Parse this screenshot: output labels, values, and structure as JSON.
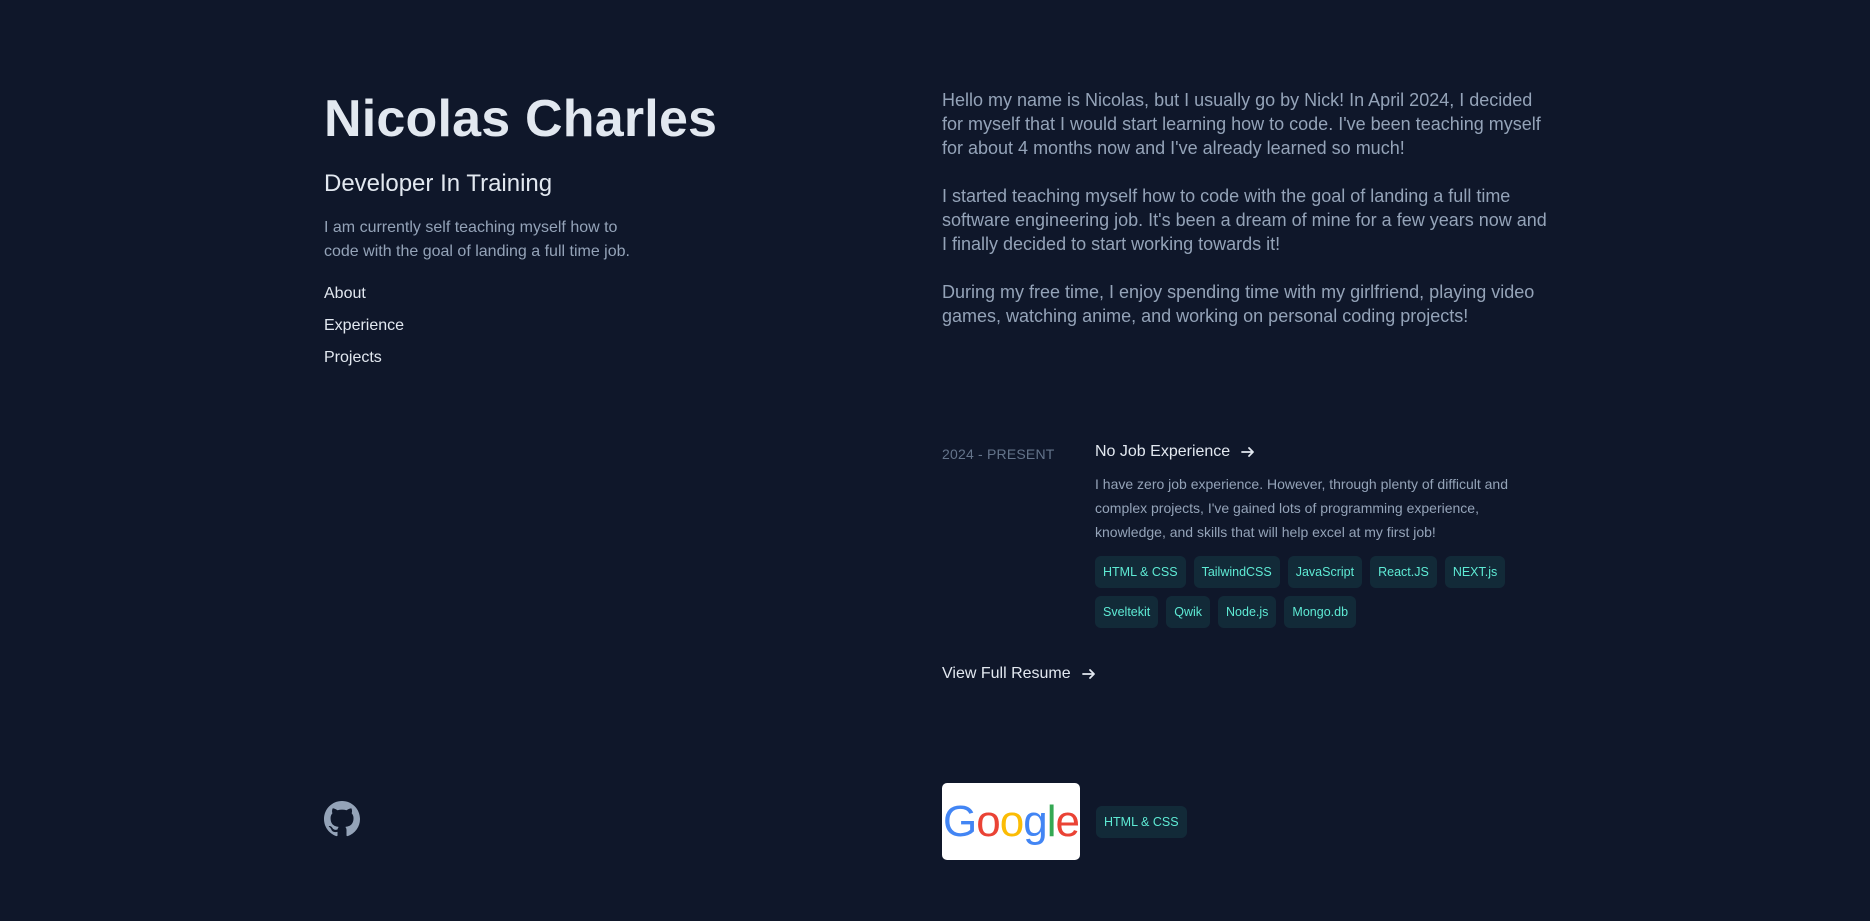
{
  "header": {
    "name": "Nicolas Charles",
    "role": "Developer In Training",
    "tagline": "I am currently self teaching myself how to code with the goal of landing a full time job."
  },
  "nav": {
    "about": "About",
    "experience": "Experience",
    "projects": "Projects"
  },
  "social": {
    "github_icon": "github-icon"
  },
  "about": {
    "p1": "Hello my name is Nicolas, but I usually go by Nick! In April 2024, I decided for myself that I would start learning how to code. I've been teaching myself for about 4 months now and I've already learned so much!",
    "p2": "I started teaching myself how to code with the goal of landing a full time software engineering job. It's been a dream of mine for a few years now and I finally decided to start working towards it!",
    "p3": "During my free time, I enjoy spending time with my girlfriend, playing video games, watching anime, and working on personal coding projects!"
  },
  "experience": {
    "date": "2024 - PRESENT",
    "title": "No Job Experience",
    "description": "I have zero job experience. However, through plenty of difficult and complex projects, I've gained lots of programming experience, knowledge, and skills that will help excel at my first job!",
    "tags": [
      "HTML & CSS",
      "TailwindCSS",
      "JavaScript",
      "React.JS",
      "NEXT.js",
      "Sveltekit",
      "Qwik",
      "Node.js",
      "Mongo.db"
    ]
  },
  "resume": {
    "label": "View Full Resume"
  },
  "project": {
    "thumbnail_letters": [
      "G",
      "o",
      "o",
      "g",
      "l",
      "e"
    ],
    "tag": "HTML & CSS"
  },
  "colors": {
    "background": "#0f172a",
    "heading": "#e2e8f0",
    "body": "#94a3b8",
    "tag_text": "#5eead4",
    "google_blue": "#4285F4",
    "google_red": "#EA4335",
    "google_yellow": "#FBBC05",
    "google_green": "#34A853"
  }
}
